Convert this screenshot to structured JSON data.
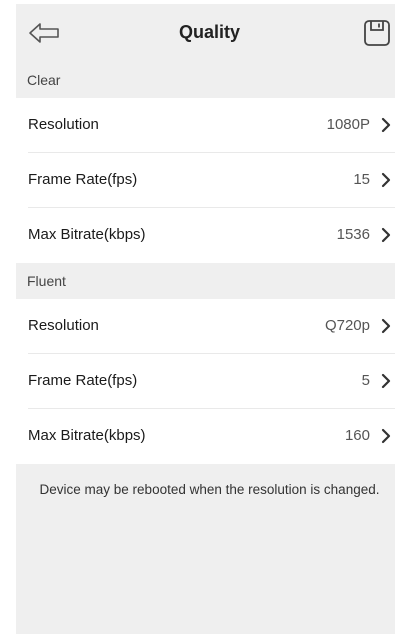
{
  "header": {
    "title": "Quality",
    "back_icon": "back-arrow-icon",
    "save_icon": "save-icon"
  },
  "sections": [
    {
      "label": "Clear",
      "rows": [
        {
          "label": "Resolution",
          "value": "1080P"
        },
        {
          "label": "Frame Rate(fps)",
          "value": "15"
        },
        {
          "label": "Max Bitrate(kbps)",
          "value": "1536"
        }
      ]
    },
    {
      "label": "Fluent",
      "rows": [
        {
          "label": "Resolution",
          "value": "Q720p"
        },
        {
          "label": "Frame Rate(fps)",
          "value": "5"
        },
        {
          "label": "Max Bitrate(kbps)",
          "value": "160"
        }
      ]
    }
  ],
  "footer": {
    "note": "Device may be rebooted when the resolution is changed."
  },
  "colors": {
    "background": "#efefef",
    "row_background": "#ffffff",
    "text": "#1a1a1a"
  }
}
